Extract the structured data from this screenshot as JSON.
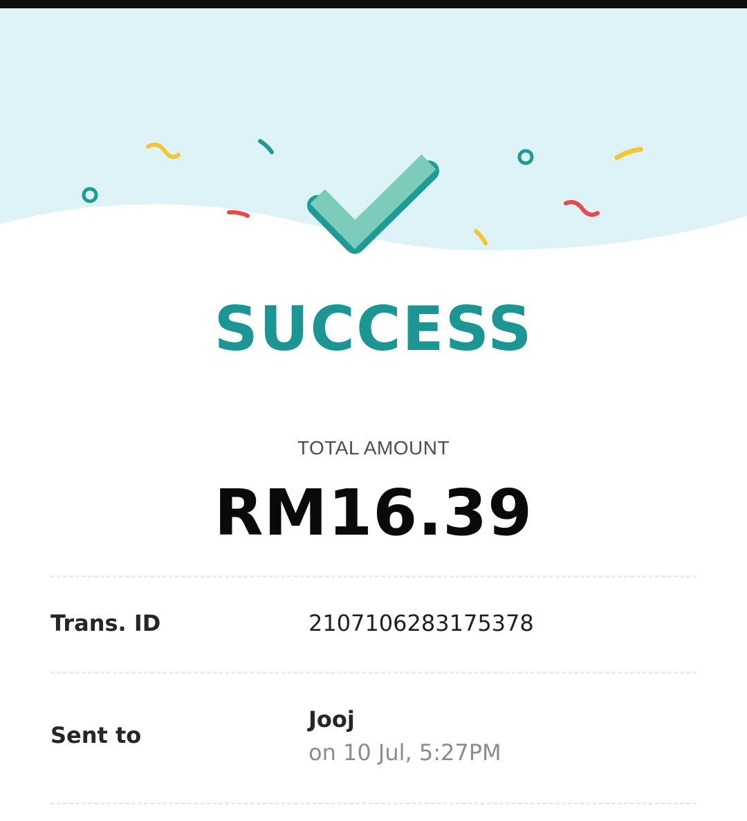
{
  "status": {
    "title": "SUCCESS"
  },
  "total": {
    "label": "TOTAL AMOUNT",
    "amount": "RM16.39"
  },
  "details": {
    "trans_id_label": "Trans. ID",
    "trans_id_value": "2107106283175378",
    "sent_to_label": "Sent to",
    "recipient": "Jooj",
    "datetime": "on 10 Jul, 5:27PM"
  },
  "icons": {
    "status": "check-icon",
    "decor": "confetti"
  },
  "colors": {
    "accent": "#1c9694",
    "check_light": "#7cccbb",
    "check_dark": "#1f9a94",
    "hero_bg": "#ddf3f8",
    "confetti_yellow": "#f6c533",
    "confetti_red": "#e84a4a",
    "confetti_teal": "#1f9a94"
  }
}
